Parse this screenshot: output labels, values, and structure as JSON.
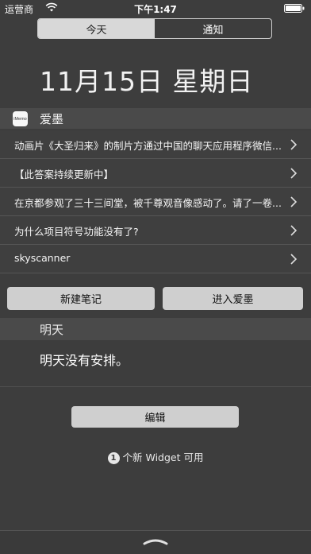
{
  "status_bar": {
    "carrier": "运营商",
    "time": "下午1:47"
  },
  "tabs": [
    {
      "label": "今天",
      "active": true
    },
    {
      "label": "通知",
      "active": false
    }
  ],
  "date_title": "11月15日 星期日",
  "widget": {
    "icon_text": "iMemo",
    "title": "爱墨",
    "items": [
      {
        "text": "动画片《大圣归来》的制片方通过中国的聊天应用程序微信..."
      },
      {
        "text": "【此答案持续更新中】"
      },
      {
        "text": "在京都参观了三十三间堂，被千尊观音像感动了。请了一卷..."
      },
      {
        "text": "为什么项目符号功能没有了?"
      },
      {
        "text": "skyscanner"
      }
    ],
    "buttons": {
      "new_note": "新建笔记",
      "open_app": "进入爱墨"
    }
  },
  "tomorrow": {
    "title": "明天",
    "message": "明天没有安排。"
  },
  "edit_button": "编辑",
  "new_widgets": {
    "count": "1",
    "label": "个新 Widget 可用"
  },
  "icons": {
    "wifi": "wifi-icon",
    "battery": "battery-icon",
    "chevron": "chevron-right-icon",
    "grabber": "grabber-icon"
  }
}
